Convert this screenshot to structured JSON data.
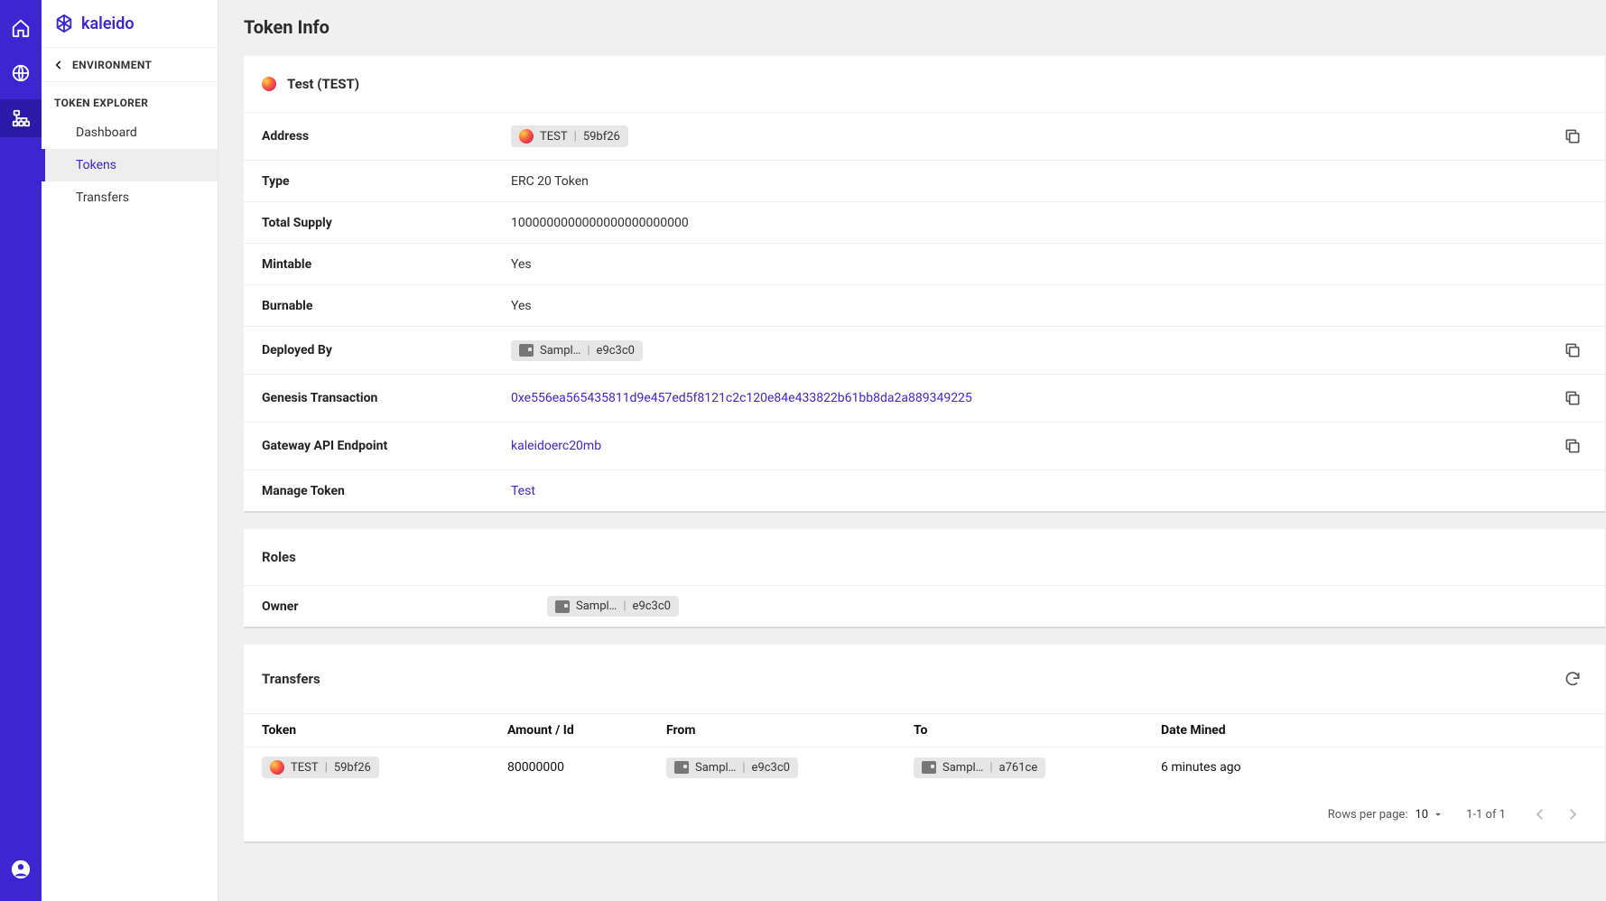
{
  "brand": "kaleido",
  "sidebar": {
    "env_label": "ENVIRONMENT",
    "section_label": "TOKEN EXPLORER",
    "items": [
      {
        "label": "Dashboard"
      },
      {
        "label": "Tokens"
      },
      {
        "label": "Transfers"
      }
    ]
  },
  "page": {
    "title": "Token Info"
  },
  "token": {
    "title": "Test (TEST)",
    "rows": {
      "address_label": "Address",
      "address_chip_name": "TEST",
      "address_chip_id": "59bf26",
      "type_label": "Type",
      "type_value": "ERC 20 Token",
      "supply_label": "Total Supply",
      "supply_value": "1000000000000000000000000",
      "mintable_label": "Mintable",
      "mintable_value": "Yes",
      "burnable_label": "Burnable",
      "burnable_value": "Yes",
      "deployed_label": "Deployed By",
      "deployed_chip_name": "Sampl…",
      "deployed_chip_id": "e9c3c0",
      "genesis_label": "Genesis Transaction",
      "genesis_value": "0xe556ea565435811d9e457ed5f8121c2c120e84e433822b61bb8da2a889349225",
      "gateway_label": "Gateway API Endpoint",
      "gateway_value": "kaleidoerc20mb",
      "manage_label": "Manage Token",
      "manage_value": "Test"
    }
  },
  "roles": {
    "title": "Roles",
    "owner_label": "Owner",
    "owner_chip_name": "Sampl…",
    "owner_chip_id": "e9c3c0"
  },
  "transfers": {
    "title": "Transfers",
    "cols": {
      "token": "Token",
      "amount": "Amount / Id",
      "from": "From",
      "to": "To",
      "date": "Date Mined"
    },
    "rows": [
      {
        "token_name": "TEST",
        "token_id": "59bf26",
        "amount": "80000000",
        "from_name": "Sampl…",
        "from_id": "e9c3c0",
        "to_name": "Sampl…",
        "to_id": "a761ce",
        "date": "6 minutes ago"
      }
    ],
    "pager": {
      "rpp_label": "Rows per page:",
      "rpp_value": "10",
      "range": "1-1 of 1"
    }
  }
}
